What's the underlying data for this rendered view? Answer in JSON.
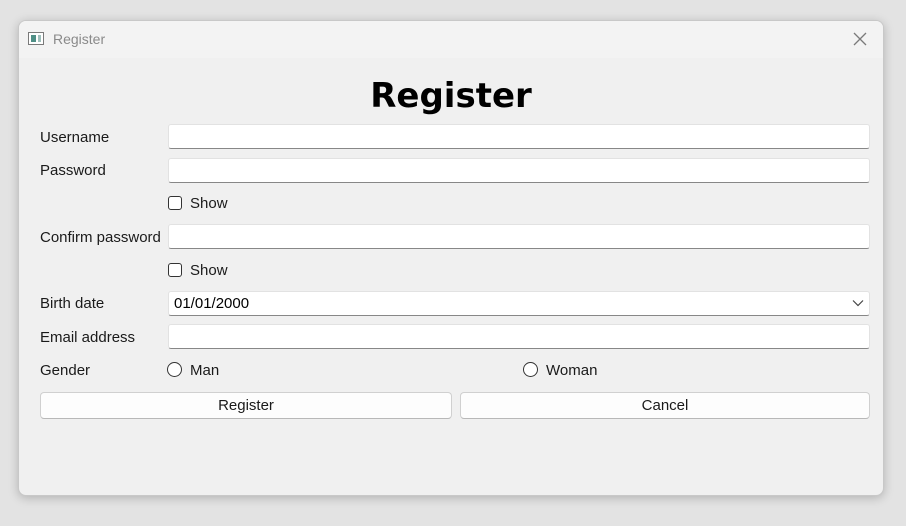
{
  "window": {
    "title": "Register",
    "close_icon": "close-icon"
  },
  "form": {
    "heading": "Register",
    "username": {
      "label": "Username",
      "value": ""
    },
    "password": {
      "label": "Password",
      "value": ""
    },
    "password_show": {
      "label": "Show",
      "checked": false
    },
    "confirm_password": {
      "label": "Confirm password",
      "value": ""
    },
    "confirm_show": {
      "label": "Show",
      "checked": false
    },
    "birth_date": {
      "label": "Birth date",
      "value": "01/01/2000"
    },
    "email": {
      "label": "Email address",
      "value": ""
    },
    "gender": {
      "label": "Gender",
      "options": [
        "Man",
        "Woman"
      ],
      "selected": null
    }
  },
  "buttons": {
    "register_label": "Register",
    "cancel_label": "Cancel"
  }
}
